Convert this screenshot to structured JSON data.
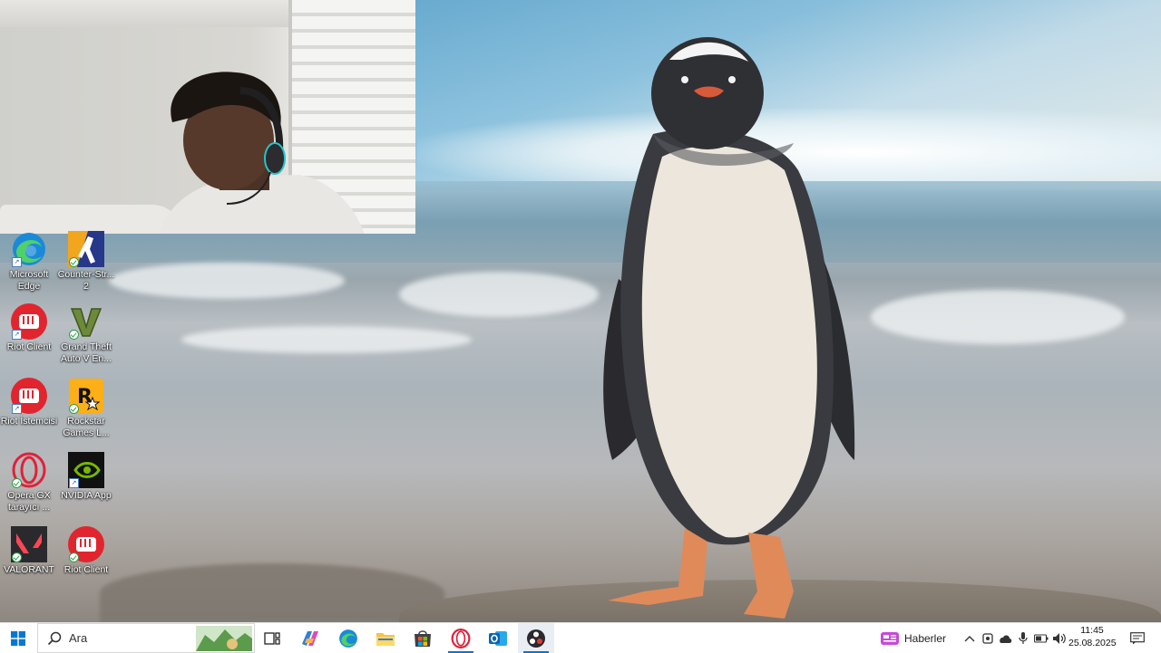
{
  "desktop": {
    "icons": [
      {
        "label": "Microsoft\nEdge",
        "icon": "edge-icon"
      },
      {
        "label": "Counter-Str...\n2",
        "icon": "counter-strike-icon"
      },
      {
        "label": "Riot Client",
        "icon": "riot-client-icon"
      },
      {
        "label": "Grand Theft\nAuto V En...",
        "icon": "gta-v-icon"
      },
      {
        "label": "Riot İstemcisi",
        "icon": "riot-client-icon"
      },
      {
        "label": "Rockstar\nGames L...",
        "icon": "rockstar-icon"
      },
      {
        "label": "Opera GX\ntarayıcı ...",
        "icon": "opera-gx-icon"
      },
      {
        "label": "NVIDIA App",
        "icon": "nvidia-icon"
      },
      {
        "label": "VALORANT",
        "icon": "valorant-icon"
      },
      {
        "label": "Riot Client",
        "icon": "riot-client-icon"
      }
    ]
  },
  "webcam": {
    "subject": "webcam-overlay"
  },
  "taskbar": {
    "search_placeholder": "Ara",
    "apps": [
      {
        "name": "task-view-icon"
      },
      {
        "name": "copilot-icon"
      },
      {
        "name": "edge-icon"
      },
      {
        "name": "file-explorer-icon"
      },
      {
        "name": "microsoft-store-icon"
      },
      {
        "name": "opera-gx-icon"
      },
      {
        "name": "outlook-icon"
      },
      {
        "name": "obs-icon"
      }
    ],
    "news_label": "Haberler",
    "time": "11:45",
    "date": "25.08.2025"
  },
  "colors": {
    "accent": "#0078d4",
    "riot_red": "#e0252f",
    "opera_red": "#e0213a",
    "nvidia_green": "#76b900"
  }
}
